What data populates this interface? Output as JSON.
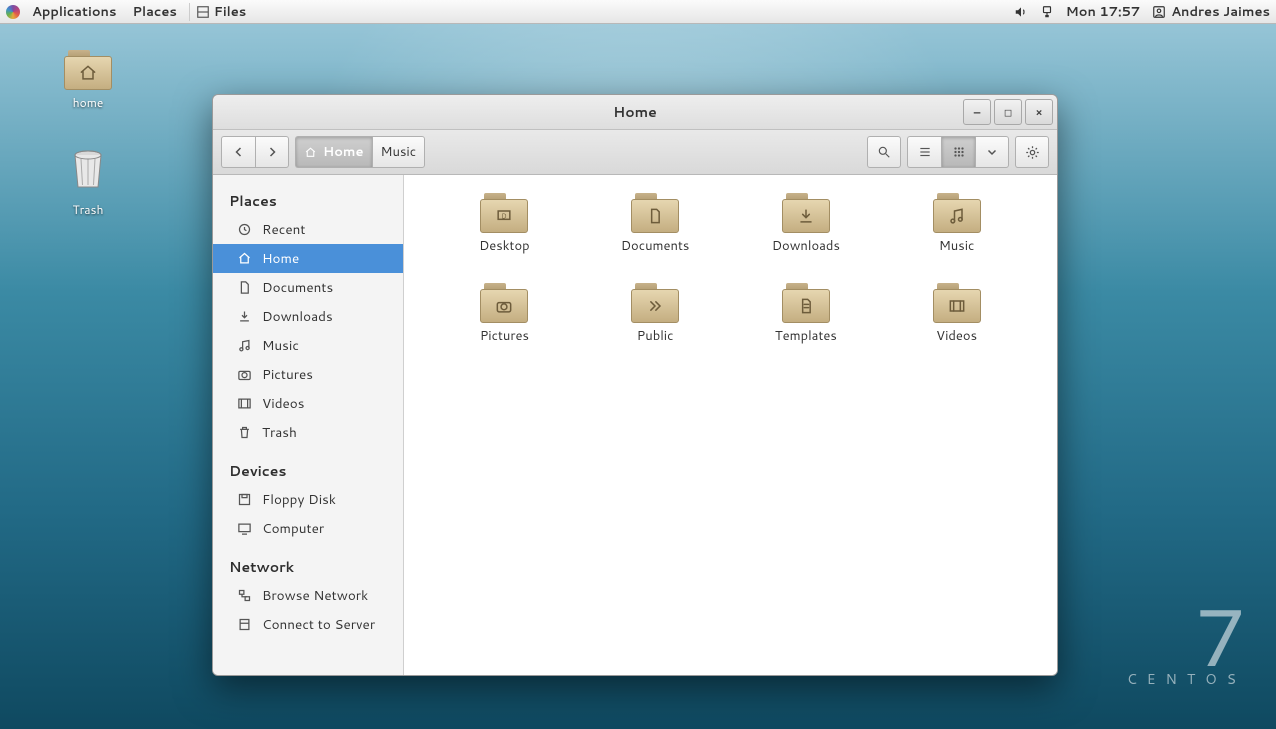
{
  "panel": {
    "applications": "Applications",
    "places": "Places",
    "task_app": "Files",
    "clock": "Mon 17:57",
    "user": "Andres Jaimes"
  },
  "desktop_icons": {
    "home": "home",
    "trash": "Trash"
  },
  "watermark": {
    "big": "7",
    "brand": "CENTOS"
  },
  "window": {
    "title": "Home",
    "path": {
      "current": "Home",
      "next": "Music"
    },
    "winbtns": {
      "min": "—",
      "max": "□",
      "close": "×"
    }
  },
  "sidebar": {
    "places_hdr": "Places",
    "devices_hdr": "Devices",
    "network_hdr": "Network",
    "recent": "Recent",
    "home": "Home",
    "documents": "Documents",
    "downloads": "Downloads",
    "music": "Music",
    "pictures": "Pictures",
    "videos": "Videos",
    "trash": "Trash",
    "floppy": "Floppy Disk",
    "computer": "Computer",
    "browse_net": "Browse Network",
    "connect_srv": "Connect to Server"
  },
  "folders": {
    "desktop": "Desktop",
    "documents": "Documents",
    "downloads": "Downloads",
    "music": "Music",
    "pictures": "Pictures",
    "public": "Public",
    "templates": "Templates",
    "videos": "Videos"
  }
}
